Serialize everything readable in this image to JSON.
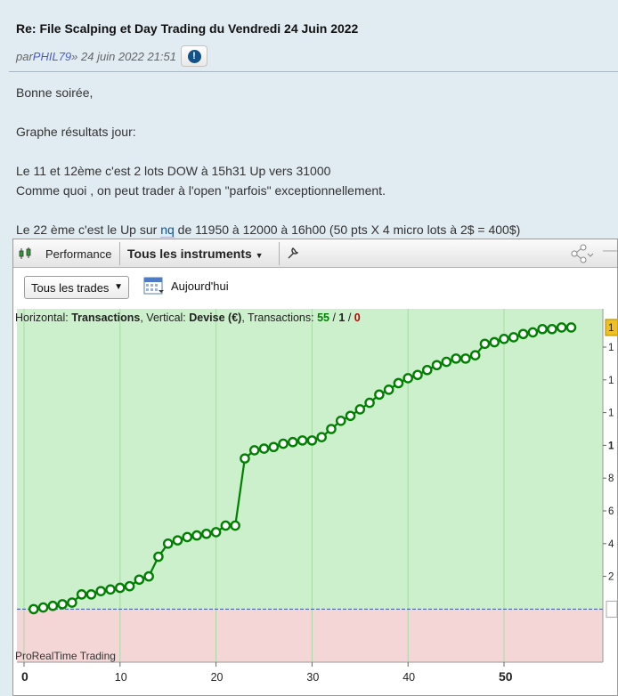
{
  "post": {
    "title": "Re: File Scalping et Day Trading du Vendredi 24 Juin 2022",
    "by_prefix": "par ",
    "author": "PHIL79",
    "date": " » 24 juin 2022 21:51",
    "report_icon": "exclamation-icon",
    "lines": {
      "greeting": "Bonne soirée,",
      "graph": "Graphe résultats jour:",
      "l1": "Le 11 et 12ème c'est 2 lots DOW à 15h31 Up vers 31000",
      "l2": "Comme quoi , on peut trader à l'open \"parfois\" exceptionnellement.",
      "l3_before": "Le 22 ème c'est le Up sur ",
      "l3_link": "nq",
      "l3_after": " de 11950 à 12000 à 16h00 (50 pts X 4 micro lots à 2$ = 400$)"
    }
  },
  "app": {
    "toolbar": {
      "performance": "Performance",
      "instruments": "Tous les instruments",
      "instruments_caret": "▼",
      "wrench_icon": "wrench-icon",
      "share_icon": "share-icon",
      "minimize": "—"
    },
    "filters": {
      "trades": "Tous les trades",
      "trades_caret": "▼",
      "today": "Aujourd'hui"
    },
    "chart_header": {
      "h_label": "Horizontal: ",
      "h_value": "Transactions",
      "v_label": ", Vertical: ",
      "v_value": "Devise (€)",
      "t_label": ", Transactions: ",
      "t_win": "55",
      "t_sep1": " / ",
      "t_neutral": "1",
      "t_sep2": " / ",
      "t_loss": "0"
    },
    "watermark": "ProRealTime Trading",
    "colors": {
      "profit_bg": "#ccefcc",
      "loss_bg": "#f4d6d6",
      "line": "#008000",
      "win": "#008000",
      "loss": "#c00000"
    }
  },
  "chart_data": {
    "type": "line",
    "x": [
      1,
      2,
      3,
      4,
      5,
      6,
      7,
      8,
      9,
      10,
      11,
      12,
      13,
      14,
      15,
      16,
      17,
      18,
      19,
      20,
      21,
      22,
      23,
      24,
      25,
      26,
      27,
      28,
      29,
      30,
      31,
      32,
      33,
      34,
      35,
      36,
      37,
      38,
      39,
      40,
      41,
      42,
      43,
      44,
      45,
      46,
      47,
      48,
      49,
      50,
      51,
      52,
      53,
      54,
      55,
      56,
      57
    ],
    "y": [
      0,
      0.1,
      0.2,
      0.3,
      0.4,
      0.9,
      0.9,
      1.1,
      1.2,
      1.3,
      1.4,
      1.8,
      2.0,
      3.2,
      4.0,
      4.2,
      4.4,
      4.5,
      4.6,
      4.7,
      5.1,
      5.1,
      9.2,
      9.7,
      9.8,
      9.9,
      10.1,
      10.2,
      10.3,
      10.3,
      10.5,
      11.0,
      11.5,
      11.8,
      12.2,
      12.6,
      13.1,
      13.4,
      13.8,
      14.1,
      14.3,
      14.6,
      14.9,
      15.1,
      15.3,
      15.3,
      15.5,
      16.2,
      16.3,
      16.5,
      16.6,
      16.8,
      16.9,
      17.1,
      17.1,
      17.2,
      17.2
    ],
    "xlabel": "",
    "ylabel": "",
    "xticks": [
      "0",
      "10",
      "20",
      "30",
      "40",
      "50"
    ],
    "xlim": [
      0,
      60
    ],
    "ylim": [
      -1.5,
      18.5
    ],
    "yticks": [
      "2",
      "4",
      "6",
      "8",
      "1",
      "1",
      "1",
      "1"
    ],
    "y_last_label": "1",
    "grid": true
  }
}
